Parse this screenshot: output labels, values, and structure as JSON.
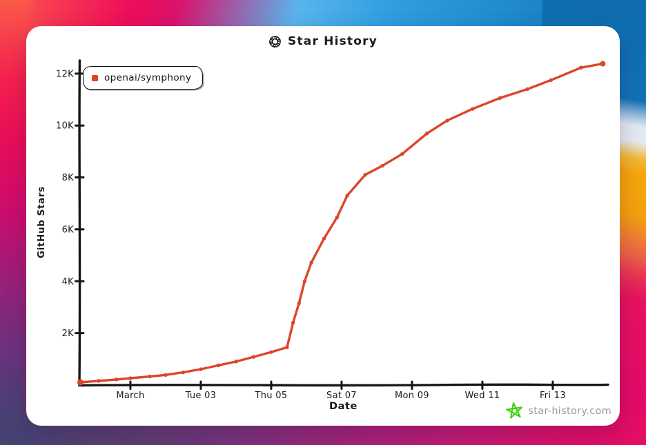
{
  "header": {
    "title": "Star History",
    "logo_icon": "openai-logo-icon"
  },
  "legend": {
    "items": [
      {
        "label": "openai/symphony",
        "color": "#dd4528"
      }
    ]
  },
  "footer": {
    "brand": "star-history.com",
    "star_icon": "star-doodle-icon",
    "star_color": "#3fd00f",
    "text_color": "#9a9a9a"
  },
  "chart_data": {
    "type": "line",
    "title": "Star History",
    "xlabel": "Date",
    "ylabel": "GitHub Stars",
    "legend_position": "top-left",
    "grid": false,
    "x_unit": "days (day 2 = Mar 01 2026)",
    "xlim": [
      0.55,
      15.55
    ],
    "ylim": [
      0,
      12500
    ],
    "x_ticks": [
      {
        "day": 2,
        "label": "March"
      },
      {
        "day": 4,
        "label": "Tue 03"
      },
      {
        "day": 6,
        "label": "Thu 05"
      },
      {
        "day": 8,
        "label": "Sat 07"
      },
      {
        "day": 10,
        "label": "Mon 09"
      },
      {
        "day": 12,
        "label": "Wed 11"
      },
      {
        "day": 14,
        "label": "Fri 13"
      }
    ],
    "y_ticks": [
      {
        "value": 2000,
        "label": "2K"
      },
      {
        "value": 4000,
        "label": "4K"
      },
      {
        "value": 6000,
        "label": "6K"
      },
      {
        "value": 8000,
        "label": "8K"
      },
      {
        "value": 10000,
        "label": "10K"
      },
      {
        "value": 12000,
        "label": "12K"
      }
    ],
    "series": [
      {
        "name": "openai/symphony",
        "color": "#dd4528",
        "points": [
          [
            0.58,
            105
          ],
          [
            1.1,
            160
          ],
          [
            1.6,
            215
          ],
          [
            2.0,
            265
          ],
          [
            2.55,
            330
          ],
          [
            3.0,
            390
          ],
          [
            3.5,
            490
          ],
          [
            4.0,
            610
          ],
          [
            4.5,
            760
          ],
          [
            5.0,
            905
          ],
          [
            5.5,
            1085
          ],
          [
            6.0,
            1270
          ],
          [
            6.45,
            1455
          ],
          [
            6.62,
            2400
          ],
          [
            6.79,
            3150
          ],
          [
            6.95,
            4000
          ],
          [
            7.14,
            4720
          ],
          [
            7.5,
            5640
          ],
          [
            7.87,
            6460
          ],
          [
            8.16,
            7300
          ],
          [
            8.67,
            8100
          ],
          [
            9.16,
            8450
          ],
          [
            9.72,
            8900
          ],
          [
            10.42,
            9690
          ],
          [
            11.0,
            10190
          ],
          [
            11.72,
            10640
          ],
          [
            12.5,
            11060
          ],
          [
            13.28,
            11400
          ],
          [
            13.95,
            11750
          ],
          [
            14.8,
            12230
          ],
          [
            15.42,
            12380
          ]
        ]
      }
    ]
  }
}
